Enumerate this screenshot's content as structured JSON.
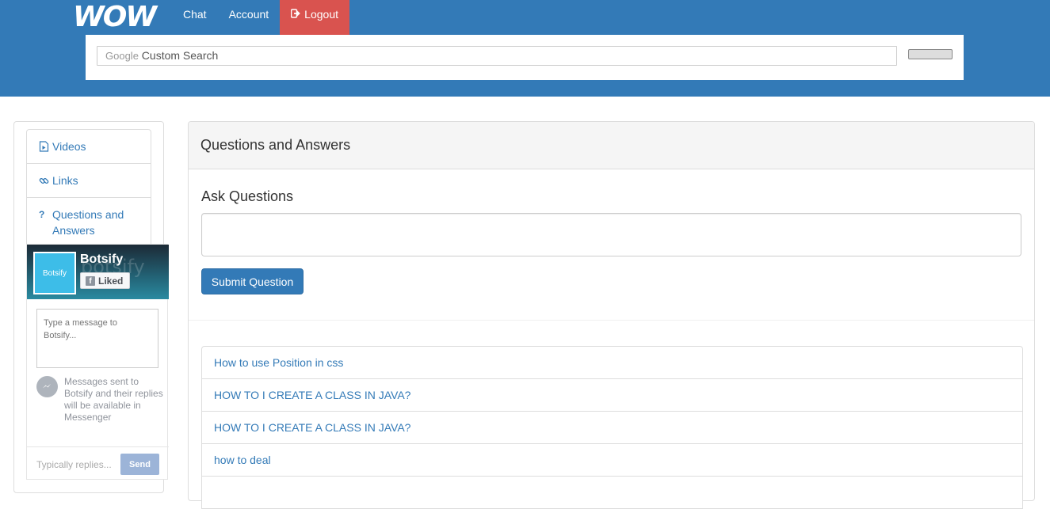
{
  "header": {
    "logo_text": "WOW",
    "nav": {
      "chat": "Chat",
      "account": "Account",
      "logout": "Logout"
    },
    "search": {
      "brand": "Google",
      "placeholder": " Custom Search"
    }
  },
  "sidebar": {
    "items": [
      {
        "label": "Videos",
        "icon": "video-file-icon"
      },
      {
        "label": "Links",
        "icon": "link-icon"
      },
      {
        "label": "Questions and Answers",
        "icon": "question-icon"
      }
    ]
  },
  "widget": {
    "page_name": "Botsify",
    "avatar_text": "Botsify",
    "liked_label": "Liked",
    "message_placeholder": "Type a message to Botsify...",
    "info_text": "Messages sent to Botsify and their replies will be available in Messenger",
    "reply_placeholder": "Typically replies...",
    "send_label": "Send"
  },
  "main": {
    "heading": "Questions and Answers",
    "ask_title": "Ask Questions",
    "submit_label": "Submit Question",
    "questions": [
      "How to use Position in css",
      "HOW TO I CREATE A CLASS IN JAVA?",
      "HOW TO I CREATE A CLASS IN JAVA?",
      "how to deal",
      ""
    ]
  },
  "colors": {
    "brand_blue": "#337ab7",
    "logout_red": "#d9534f",
    "link_blue": "#337ab7"
  }
}
